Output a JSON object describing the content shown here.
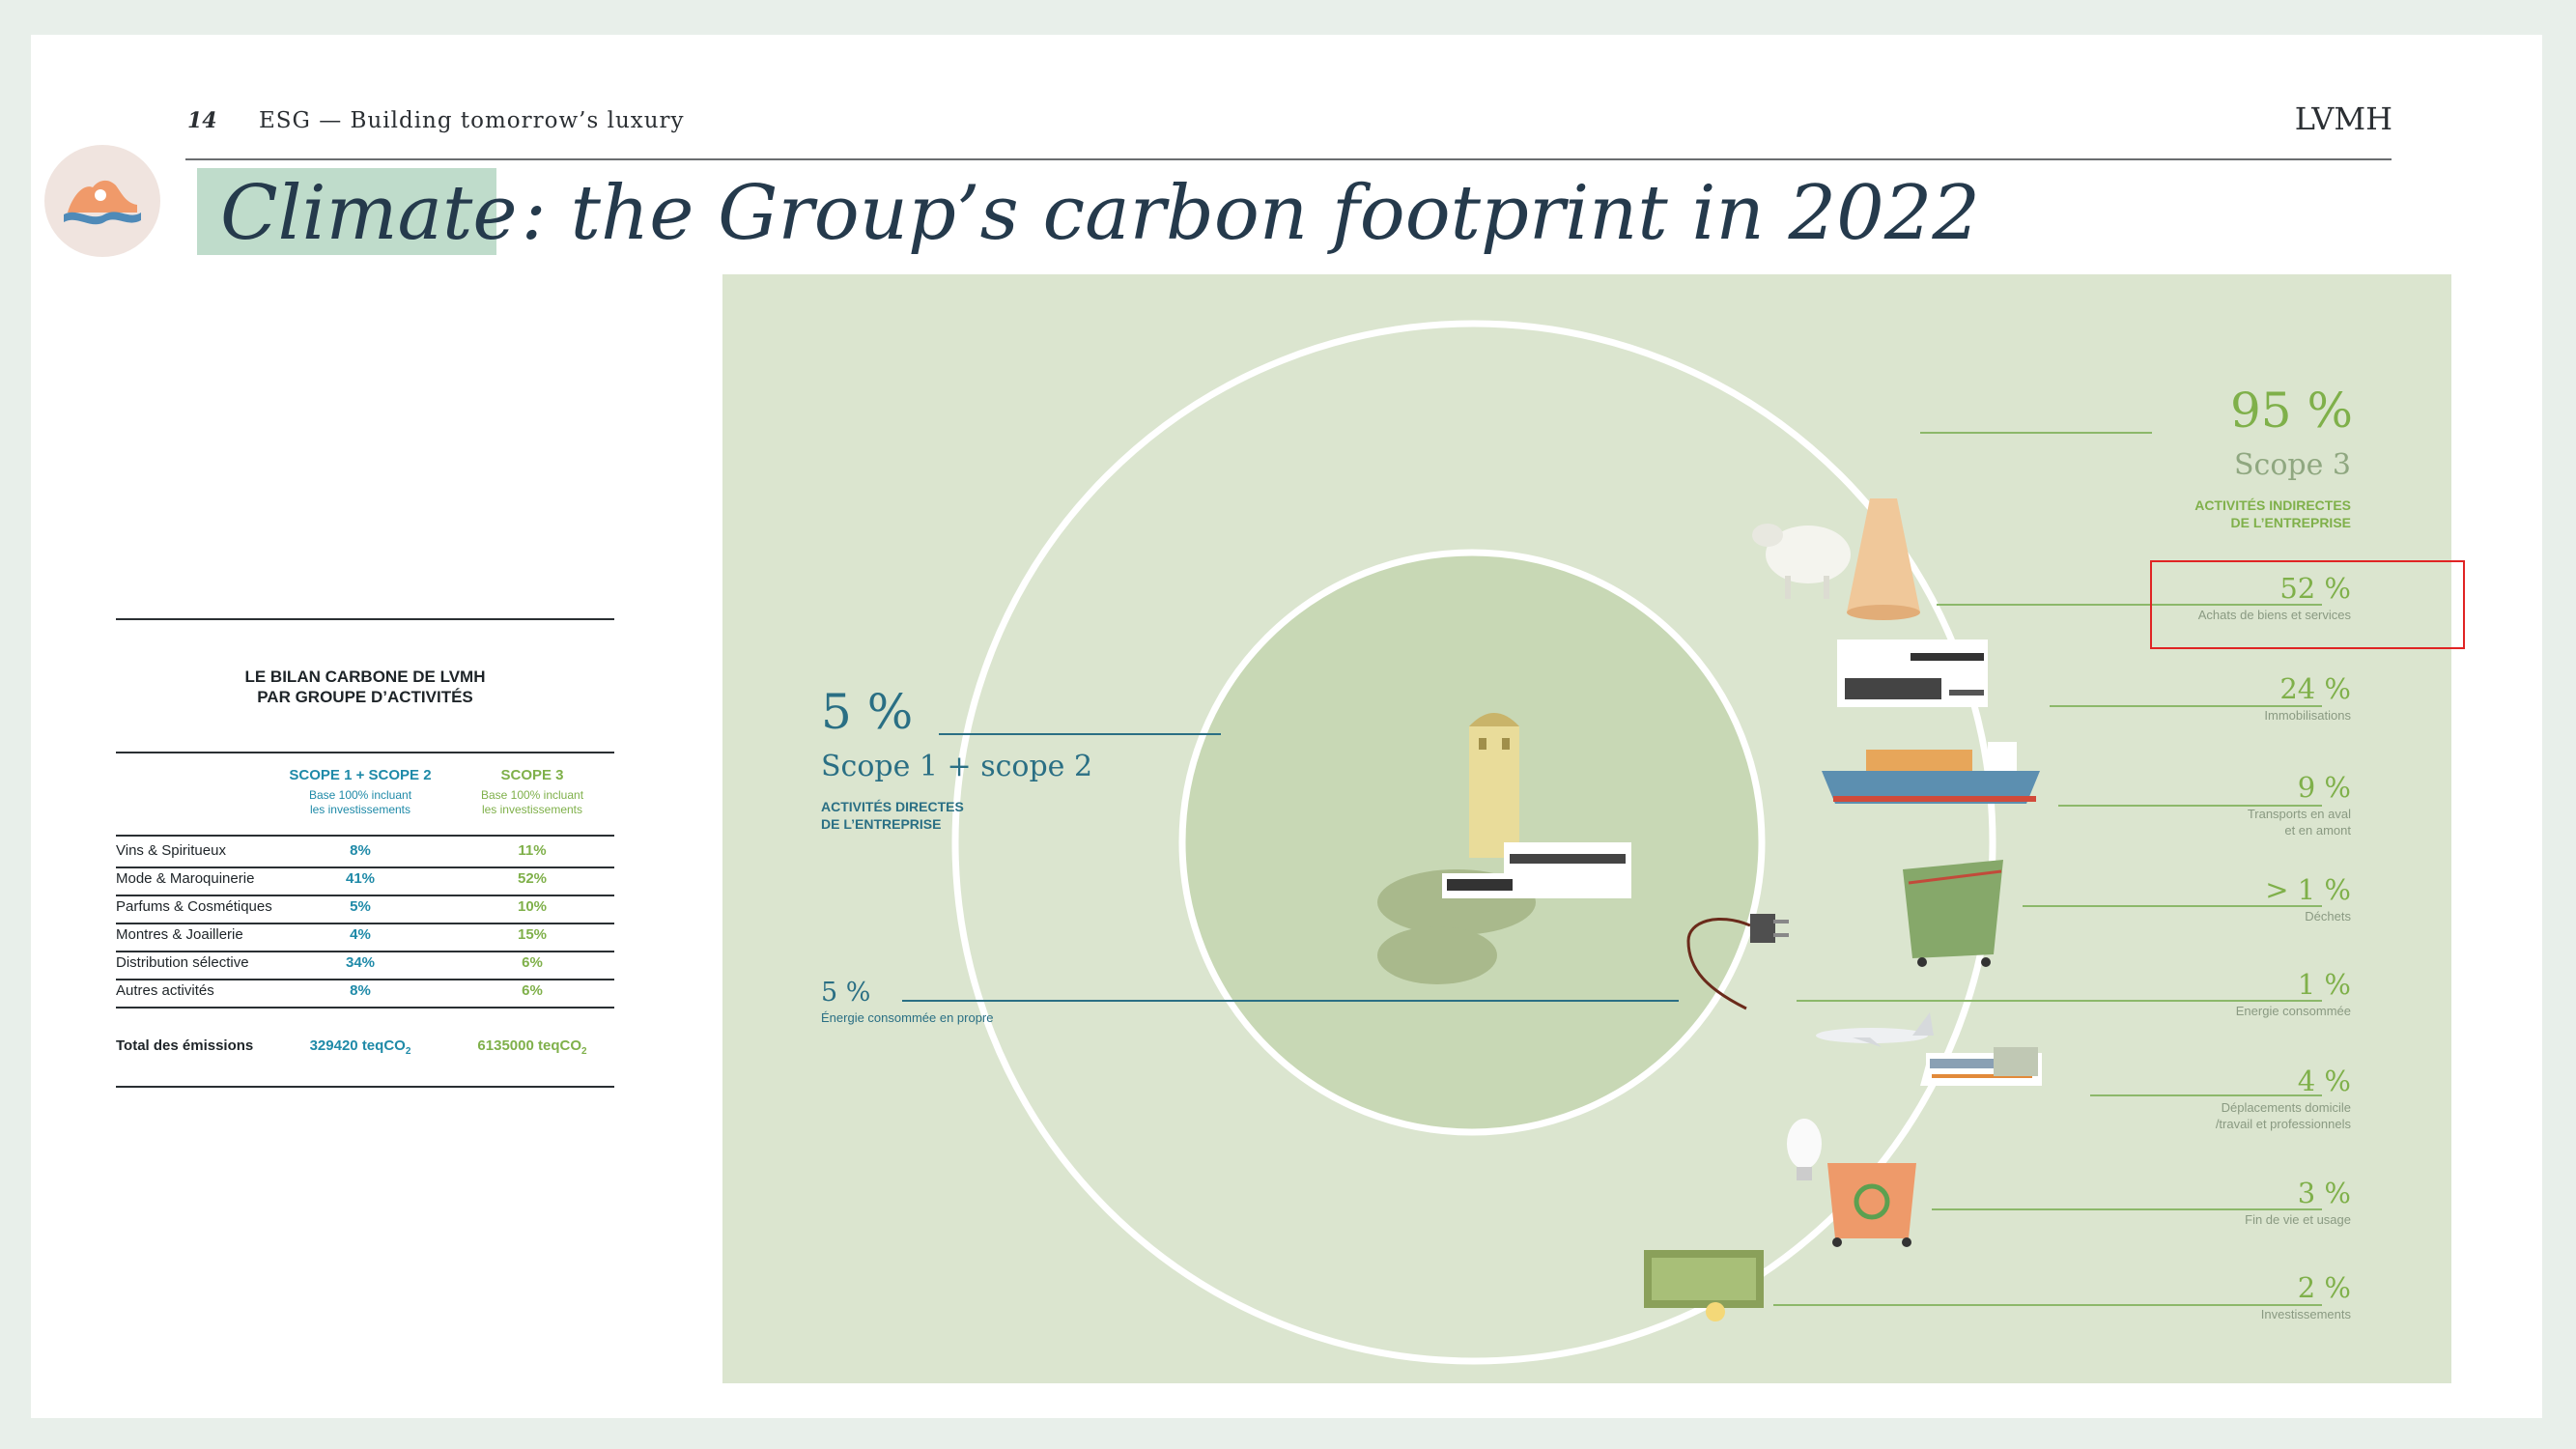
{
  "header": {
    "page_number": "14",
    "section": "ESG — Building tomorrow’s luxury",
    "brand": "LVMH"
  },
  "title": {
    "highlight": "Climate",
    "rest": ": the Group’s carbon footprint in 2022"
  },
  "table": {
    "title_line1": "LE BILAN CARBONE DE LVMH",
    "title_line2": "PAR GROUPE D’ACTIVITÉS",
    "col1_header": "SCOPE 1 + SCOPE 2",
    "col1_sub_line1": "Base 100% incluant",
    "col1_sub_line2": "les investissements",
    "col2_header": "SCOPE 3",
    "col2_sub_line1": "Base 100% incluant",
    "col2_sub_line2": "les investissements",
    "rows": [
      {
        "label": "Vins & Spiritueux",
        "scope12": "8%",
        "scope3": "11%"
      },
      {
        "label": "Mode & Maroquinerie",
        "scope12": "41%",
        "scope3": "52%"
      },
      {
        "label": "Parfums & Cosmétiques",
        "scope12": "5%",
        "scope3": "10%"
      },
      {
        "label": "Montres & Joaillerie",
        "scope12": "4%",
        "scope3": "15%"
      },
      {
        "label": "Distribution sélective",
        "scope12": "34%",
        "scope3": "6%"
      },
      {
        "label": "Autres activités",
        "scope12": "8%",
        "scope3": "6%"
      }
    ],
    "total_label": "Total des émissions",
    "total_scope12": "329420 teqCO",
    "total_scope3": "6135000 teqCO",
    "subscript": "2"
  },
  "diagram": {
    "scope3": {
      "pct": "95 %",
      "name": "Scope 3",
      "caps_line1": "ACTIVITÉS INDIRECTES",
      "caps_line2": "DE L’ENTREPRISE"
    },
    "scope12": {
      "pct": "5 %",
      "name": "Scope 1 + scope 2",
      "caps_line1": "ACTIVITÉS DIRECTES",
      "caps_line2": "DE L’ENTREPRISE",
      "energy_pct": "5 %",
      "energy_label": "Énergie consommée en propre"
    },
    "items": [
      {
        "pct": "52 %",
        "label1": "Achats de biens et services",
        "label2": ""
      },
      {
        "pct": "24 %",
        "label1": "Immobilisations",
        "label2": ""
      },
      {
        "pct": "9 %",
        "label1": "Transports en aval",
        "label2": "et en amont"
      },
      {
        "pct": "> 1 %",
        "label1": "Déchets",
        "label2": ""
      },
      {
        "pct": "1 %",
        "label1": "Energie consommée",
        "label2": ""
      },
      {
        "pct": "4 %",
        "label1": "Déplacements domicile",
        "label2": "/travail et professionnels"
      },
      {
        "pct": "3 %",
        "label1": "Fin de vie et usage",
        "label2": ""
      },
      {
        "pct": "2 %",
        "label1": "Investissements",
        "label2": ""
      }
    ]
  },
  "colors": {
    "title_highlight": "#bfdccb",
    "scope12_blue": "#1f8aa8",
    "scope3_green": "#7fb04a",
    "diagram_bg": "#dbe5cf",
    "highlight_box": "#e02424"
  },
  "icons": [
    "wave-logo-icon",
    "sheep-icon",
    "yarn-spool-icon",
    "factory-icon",
    "cargo-ship-icon",
    "waste-container-icon",
    "power-plug-icon",
    "airplane-icon",
    "train-icon",
    "light-bulb-icon",
    "recycle-bin-icon",
    "banknotes-icon",
    "building-icon"
  ]
}
